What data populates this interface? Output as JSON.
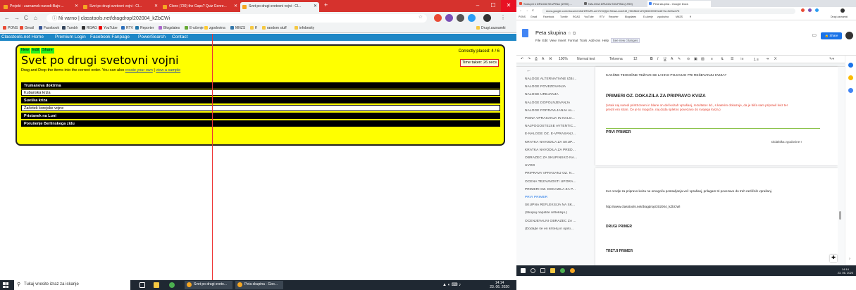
{
  "left_browser": {
    "tabs": [
      {
        "label": "Projekt - zaznamek-navodi-Bajn-..."
      },
      {
        "label": "Svet po drugi svetovni vojni - Cl..."
      },
      {
        "label": "Clone (730) the Gaps? Quiz Genre..."
      },
      {
        "label": "Svet po drugi svetovni vojni - Cl..."
      }
    ],
    "address": "Ni varno | classtools.net/dragdrop/202004_kZbCWi",
    "bookmarks": [
      "PONS",
      "Gmail",
      "Facebook",
      "Tumblr",
      "RGAG",
      "YouTube",
      "RTV",
      "Reporter",
      "Blogslates",
      "E-učenje",
      "zgodovina",
      "MNZS",
      "ff",
      "random stuff",
      "infobesity",
      "Drugi zaznamki"
    ]
  },
  "site_nav": [
    "Classtools.net Home",
    "Premium Login",
    "Facebook Fanpage",
    "PowerSearch",
    "Contact"
  ],
  "activity": {
    "mode_tabs": [
      "New",
      "Edit",
      "Share"
    ],
    "title": "Svet po drugi svetovni vojni",
    "instructions": "Drag and Drop the items into the correct order. You can also",
    "link_create": "create your own",
    "link_sep": "|",
    "link_sample": "view a sample",
    "correct_placed": "Correctly placed: 4 / 6",
    "time_taken": "Time taken: 26 secs",
    "items": [
      {
        "label": "Trumanova doktrina",
        "style": "dark"
      },
      {
        "label": "Kubanska kriza",
        "style": "light"
      },
      {
        "label": "Sueška kriza",
        "style": "dark"
      },
      {
        "label": "Začetek korejske vojne",
        "style": "light"
      },
      {
        "label": "Pristanek na Luni",
        "style": "dark"
      },
      {
        "label": "Porušenje Berlinskega zidu",
        "style": "dark"
      }
    ]
  },
  "taskbar": {
    "search_placeholder": "Tukaj vnesite izraz za iskanje",
    "apps": [
      "Svet po drugi sveto...",
      "Peta skupina - Goo..."
    ],
    "time": "14:14",
    "date": "23. 06. 2020"
  },
  "right_browser": {
    "tabs": [
      "Sodupni k DRUGA SKUPINA (1990) ...",
      "NALOGA DRUGA SKUPINA (1990)",
      "Peta skupina - Google Docs"
    ],
    "address": "docs.google.com/document/d/1R5vRl-umYtr5rQjmrS2aw-xxwXZt_H6hf6mhd7Q5DlO9KE/edit?tc=5e5w475",
    "doc_title": "Peta skupina",
    "menu": [
      "File",
      "Edit",
      "View",
      "Insert",
      "Format",
      "Tools",
      "Add-ons",
      "Help"
    ],
    "see_changes": "See new changes",
    "share": "Share",
    "toolbar": {
      "zoom": "100%",
      "style": "Normal text",
      "font": "Tekvena",
      "size": "12"
    },
    "outline": [
      "NALOGE ALTERNATIVNE IZBI...",
      "NALOGE POVEZOVANJA",
      "NALOGE UREJANJA",
      "NALOGE DOPOLNJEVANJA",
      "NALOGE POPRAVLJANJA AL...",
      "PISNA VPRAŠANJA IN NALO...",
      "NAJPOGOSTEJŠE AVTENTIČ...",
      "E-NALOGE OZ. E-VPRAŠANJ...",
      "KRATKA NAVODILA ZA SKUP...",
      "KRATKA NAVODILA ZA PRED...",
      "OBRAZEC ZA SKUPINSKO NA...",
      "UVOD",
      "PRIPRAVA VPRAŠANJ OZ. N...",
      "OCENA TEŽAVNOSTI UPORA...",
      "PRIMERI OZ. DOKAZILA ZA P...",
      "PRVI PRIMER",
      "SKUPNA REFLEKSIJA NA SK...",
      "(Skupaj napišite refleksijo.)",
      "OCENJEVALNI OBRAZEC ZA ...",
      "(Dodajte še en kriterij in opiši..."
    ],
    "active_outline_index": 15,
    "page1": {
      "question": "KAKŠNE TEHNIČNE TEŽAVE SE LAHKO POJAVIJO PRI REŠEVANJU KVIZA?",
      "heading": "PRIMERI OZ. DOKAZILA ZA PRIPRAVO KVIZA",
      "red_note": "(Vsak naj naredi printScreen in blane on del kvizah vprašanj, rezultatov itd., s katerim dokazuje, da je bil/a sam pripravil kviz ter preizil ero stran. Če je to mogoče, naj doda spletno povezavo do svojega kviza.)",
      "first_example": "PRVI PRIMER",
      "footer": "Didaktika zgodovine I"
    },
    "page2": {
      "paragraph": "Ker orodje za pripravo kviza ne omogoča postavljanja več vprašanj, prilagam tri povezave do treh različnih vprašanj.",
      "link": "http://www.classtools.net/dragdrop/202004_kZbCWi",
      "second_example": "DRUGI PRIMER",
      "third_example": "TRETJI PRIMER"
    },
    "taskbar_time": "14:14",
    "taskbar_date": "23. 06. 2020"
  },
  "colors": {
    "panel_bg": "#ffff00",
    "item_dark": "#000000",
    "nav_blue": "#1e87c6",
    "tab_red": "#d6322d",
    "guide_line": "#e33333"
  }
}
